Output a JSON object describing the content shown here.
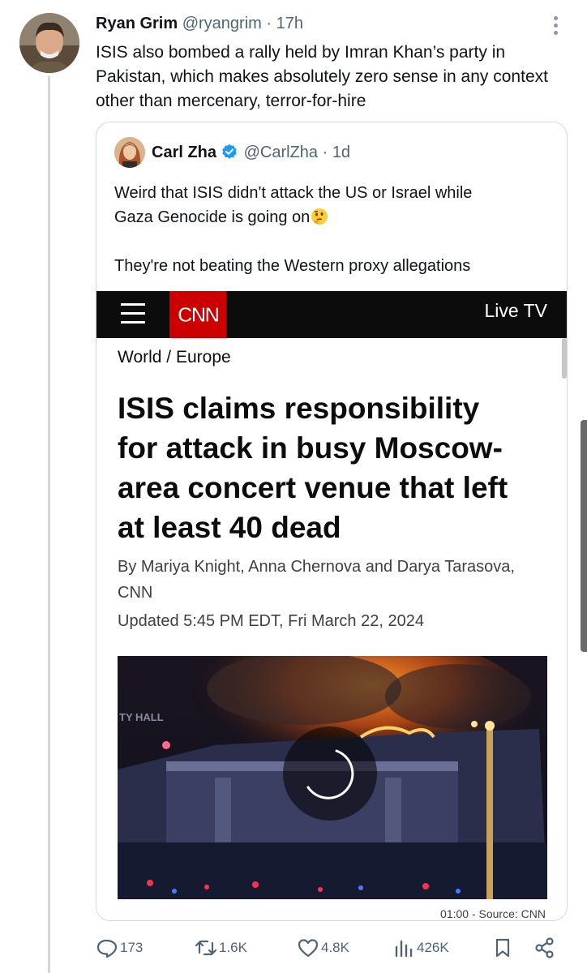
{
  "tweet": {
    "author_name": "Ryan Grim",
    "handle": "@ryangrim",
    "time": "17h",
    "text": "ISIS also bombed a rally held by Imran Khan’s party in Pakistan, which makes absolutely zero sense in any context other than mercenary, terror-for-hire"
  },
  "quoted": {
    "author_name": "Carl Zha",
    "handle": "@CarlZha",
    "time": "1d",
    "line1": "Weird that ISIS didn't attack the US or Israel while",
    "line2": "Gaza Genocide is going on",
    "emoji_icon": "thinking-face-icon",
    "line3": "They're not beating the Western proxy allegations",
    "verified_color": "#1d9bf0"
  },
  "cnn_screenshot": {
    "logo": "CNN",
    "live_tv": "Live TV",
    "breadcrumb": "World / Europe",
    "headline": "ISIS claims responsibility for attack in busy Moscow-area concert venue that left at least 40 dead",
    "byline": "By Mariya Knight, Anna Chernova and Darya Tarasova, CNN",
    "updated": "Updated 5:45 PM EDT, Fri March 22, 2024",
    "video_caption": "01:00 - Source: CNN",
    "photo_sign": "TY HALL",
    "brand_color": "#cc0000"
  },
  "actions": {
    "replies": "173",
    "reposts": "1.6K",
    "likes": "4.8K",
    "views": "426K"
  },
  "colors": {
    "muted_text": "#536471",
    "border": "#cfd9de"
  }
}
